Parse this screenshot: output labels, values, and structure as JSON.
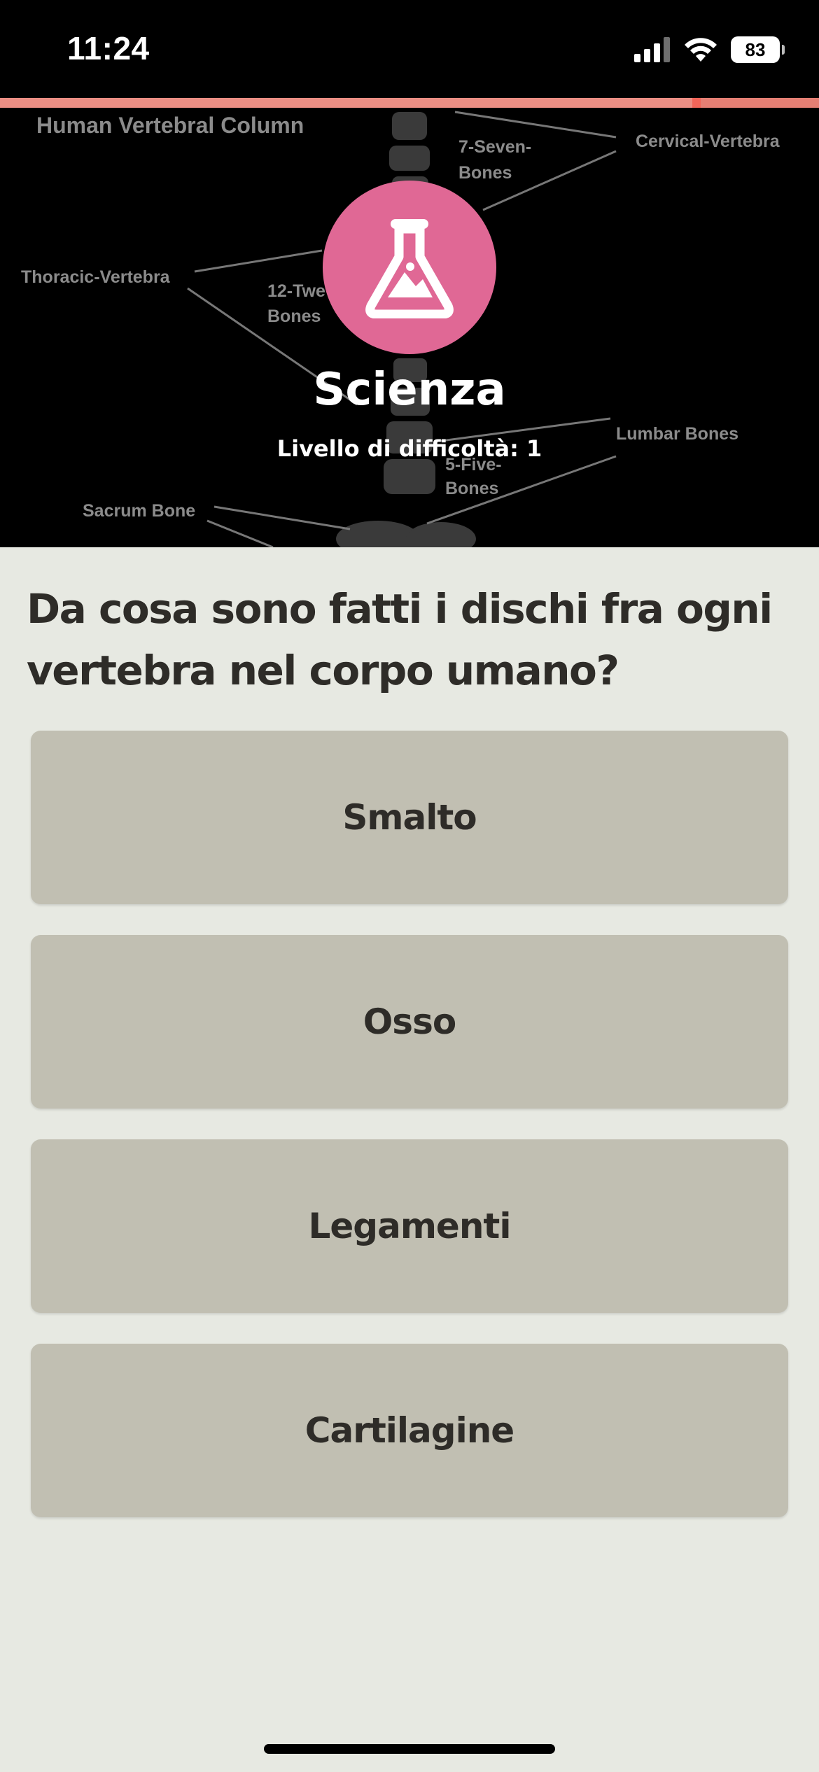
{
  "status_bar": {
    "time": "11:24",
    "battery": "83",
    "signal_icon": "cellular-signal-icon",
    "wifi_icon": "wifi-icon"
  },
  "banner": {
    "progress": 0.85,
    "background_labels": {
      "title": "Human Vertebral Column",
      "cervical": "Cervical-Vertebra",
      "seven_1": "7-Seven-",
      "seven_2": "Bones",
      "thoracic": "Thoracic-Vertebra",
      "twelve_1": "12-Twe",
      "twelve_2": "Bones",
      "lumbar": "Lumbar Bones",
      "five_1": "5-Five-",
      "five_2": "Bones",
      "sacrum": "Sacrum Bone"
    },
    "category_icon": "flask-icon",
    "category": "Scienza",
    "difficulty": "Livello di difficoltà: 1"
  },
  "question": "Da cosa sono fatti i dischi fra ogni vertebra nel corpo umano?",
  "answers": [
    {
      "label": "Smalto"
    },
    {
      "label": "Osso"
    },
    {
      "label": "Legamenti"
    },
    {
      "label": "Cartilagine"
    }
  ],
  "colors": {
    "accent": "#e06895",
    "progress": "#e57f74",
    "answer_bg": "#c1bfb2",
    "page_bg": "#e7e9e2"
  }
}
